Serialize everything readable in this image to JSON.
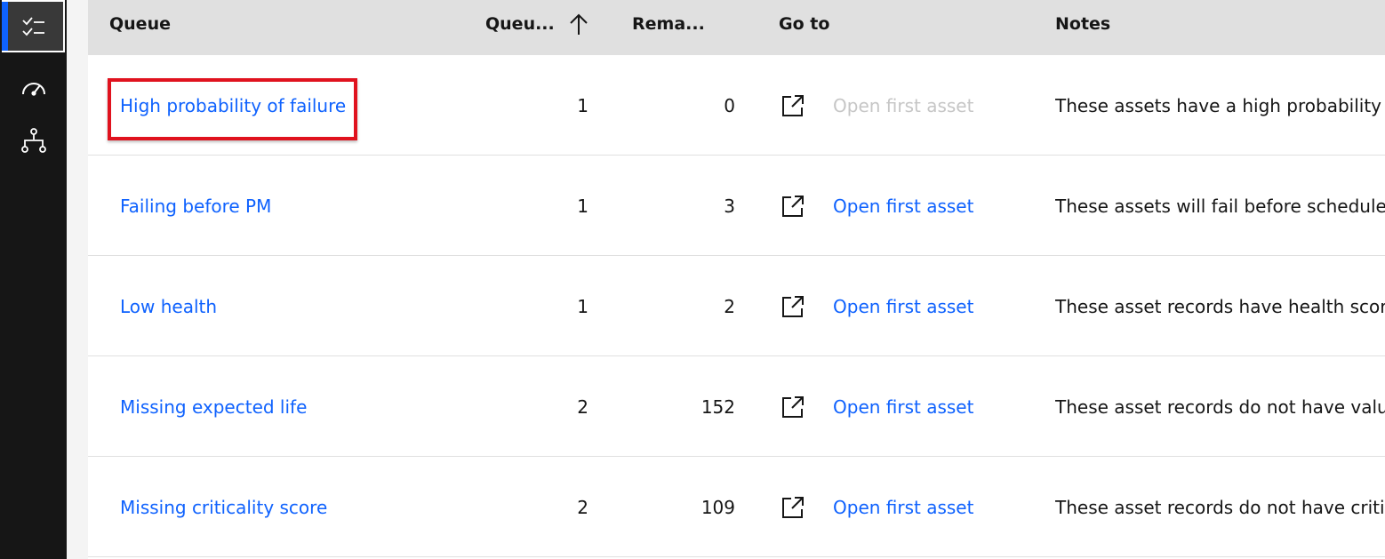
{
  "theme": {
    "accent": "#0f62fe",
    "rail_bg": "#161616",
    "header_bg": "#e0e0e0",
    "link": "#0f62fe",
    "disabled": "#c6c6c6",
    "highlight": "#e0121e"
  },
  "rail": {
    "items": [
      {
        "icon": "task-list-icon",
        "active": true
      },
      {
        "icon": "dashboard-gauge-icon",
        "active": false
      },
      {
        "icon": "hierarchy-icon",
        "active": false
      }
    ]
  },
  "table": {
    "headers": {
      "queue": "Queue",
      "queue_number": "Queu...",
      "sort_indicator": "↑",
      "remaining": "Rema...",
      "go_to": "Go to",
      "notes": "Notes"
    },
    "rows": [
      {
        "name": "High probability of failure",
        "queue_number": "1",
        "remaining": "0",
        "open_label": "Open first asset",
        "open_enabled": false,
        "notes": "These assets have a high probability of"
      },
      {
        "name": "Failing before PM",
        "queue_number": "1",
        "remaining": "3",
        "open_label": "Open first asset",
        "open_enabled": true,
        "notes": "These assets will fail before scheduled"
      },
      {
        "name": "Low health",
        "queue_number": "1",
        "remaining": "2",
        "open_label": "Open first asset",
        "open_enabled": true,
        "notes": "These asset records have health scores"
      },
      {
        "name": "Missing expected life",
        "queue_number": "2",
        "remaining": "152",
        "open_label": "Open first asset",
        "open_enabled": true,
        "notes": "These asset records do not have values"
      },
      {
        "name": "Missing criticality score",
        "queue_number": "2",
        "remaining": "109",
        "open_label": "Open first asset",
        "open_enabled": true,
        "notes": "These asset records do not have critica"
      }
    ]
  }
}
